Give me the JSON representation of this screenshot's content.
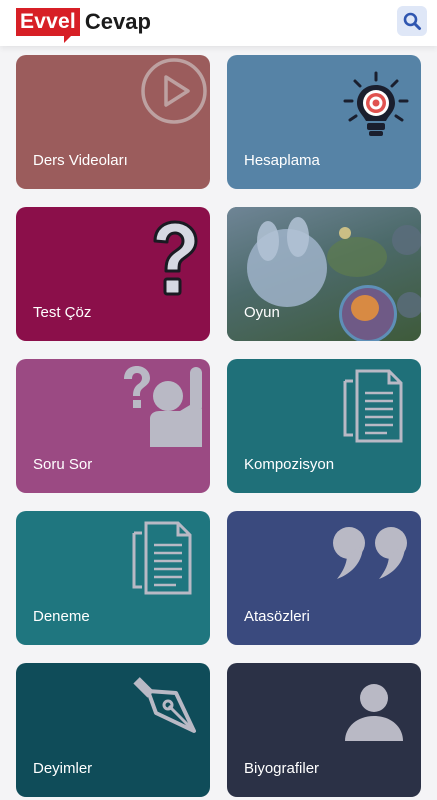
{
  "header": {
    "logo_part1": "Evvel",
    "logo_part2": "Cevap",
    "search_icon": "search-icon"
  },
  "colors": {
    "brand_red": "#d71f26",
    "search_bg": "#dfe7f7",
    "search_icon": "#2f56b0",
    "card_overlay_icon": "#b9b9c5"
  },
  "cards": [
    {
      "label": "Ders Videoları",
      "icon": "play-circle-icon",
      "color": "#9b5c5c"
    },
    {
      "label": "Hesaplama",
      "icon": "lightbulb-target-icon",
      "color": "#5683a6"
    },
    {
      "label": "Test Çöz",
      "icon": "question-mark-icon",
      "color": "#8b0f4a"
    },
    {
      "label": "Oyun",
      "icon": "game-characters-image",
      "color": "#4f6b6b"
    },
    {
      "label": "Soru Sor",
      "icon": "raise-hand-question-icon",
      "color": "#9b4a83"
    },
    {
      "label": "Kompozisyon",
      "icon": "documents-icon",
      "color": "#1f7079"
    },
    {
      "label": "Deneme",
      "icon": "documents-icon",
      "color": "#1f767f"
    },
    {
      "label": "Atasözleri",
      "icon": "quote-icon",
      "color": "#3a4a7e"
    },
    {
      "label": "Deyimler",
      "icon": "fountain-pen-icon",
      "color": "#0f4c59"
    },
    {
      "label": "Biyografiler",
      "icon": "person-icon",
      "color": "#2b3146"
    }
  ]
}
